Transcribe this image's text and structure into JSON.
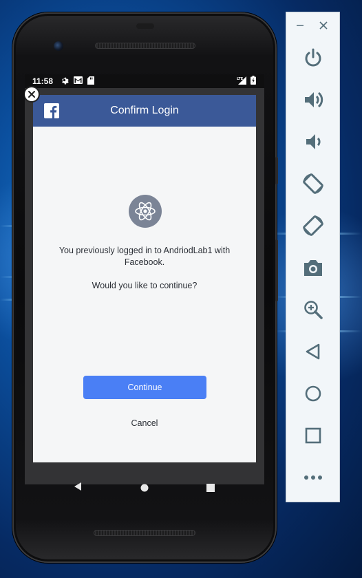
{
  "status_bar": {
    "time": "11:58"
  },
  "dialog": {
    "title": "Confirm Login",
    "message_line1": "You previously logged in to AndriodLab1 with",
    "message_line2": "Facebook.",
    "question": "Would you like to continue?",
    "continue_label": "Continue",
    "cancel_label": "Cancel"
  },
  "icons": {
    "facebook": "facebook-logo-icon",
    "close": "close-icon",
    "app": "react-atom-icon",
    "nav_back": "back-triangle-icon",
    "nav_home": "home-circle-icon",
    "nav_overview": "overview-square-icon",
    "power": "power-icon",
    "volume_up": "volume-up-icon",
    "volume_down": "volume-down-icon",
    "rotate_left": "rotate-left-icon",
    "rotate_right": "rotate-right-icon",
    "camera": "camera-icon",
    "zoom": "zoom-icon",
    "more": "more-icon"
  },
  "colors": {
    "facebook_blue": "#3b5998",
    "continue_blue": "#4a7ff5",
    "toolbar_icon": "#546e7a"
  }
}
